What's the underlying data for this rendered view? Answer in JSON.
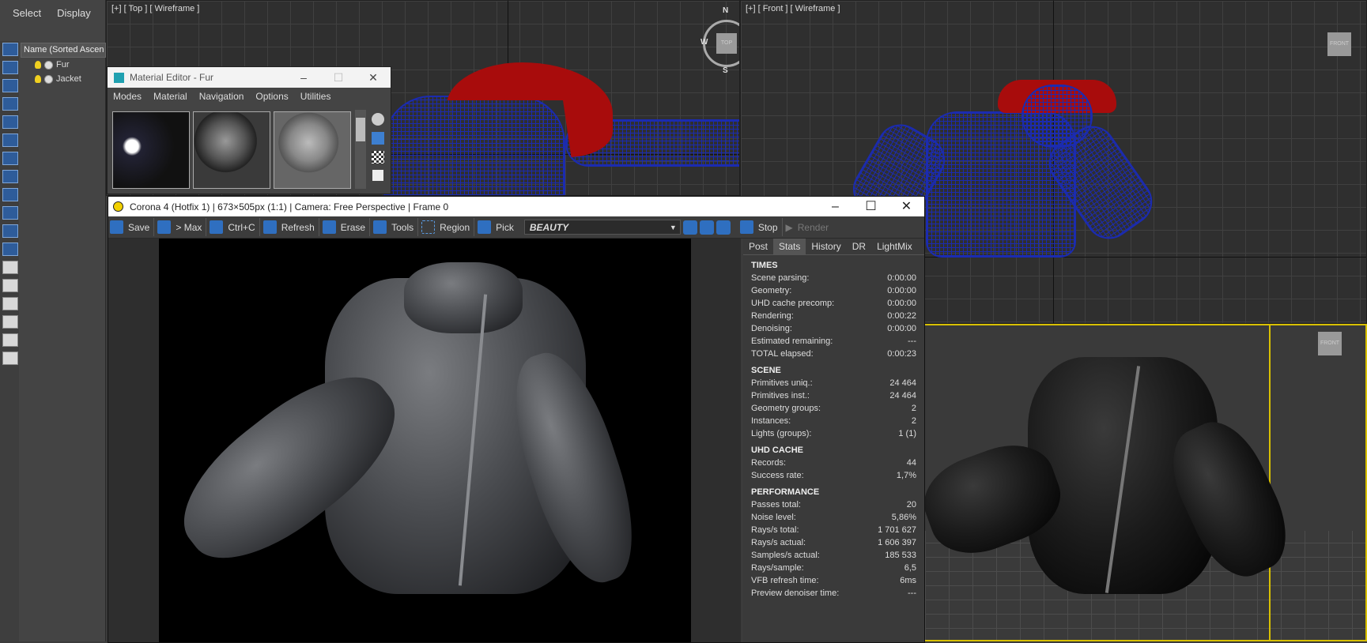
{
  "explorer": {
    "menu": [
      "Select",
      "Display"
    ],
    "column_header": "Name (Sorted Ascen",
    "nodes": [
      "Fur",
      "Jacket"
    ]
  },
  "viewport_top": {
    "label": "[+] [ Top ] [ Wireframe ]",
    "compass": {
      "n": "N",
      "s": "S",
      "e": "E",
      "w": "W",
      "center": "TOP"
    }
  },
  "viewport_front": {
    "label": "[+] [ Front ] [ Wireframe ]",
    "cube": "FRONT"
  },
  "viewport_persp": {
    "cube": "FRONT"
  },
  "material_editor": {
    "title": "Material Editor - Fur",
    "menus": [
      "Modes",
      "Material",
      "Navigation",
      "Options",
      "Utilities"
    ]
  },
  "corona": {
    "title": "Corona 4 (Hotfix 1) | 673×505px (1:1) | Camera: Free Perspective | Frame 0",
    "toolbar": {
      "save": "Save",
      "max": "> Max",
      "copy": "Ctrl+C",
      "refresh": "Refresh",
      "erase": "Erase",
      "tools": "Tools",
      "region": "Region",
      "pick": "Pick",
      "pass": "BEAUTY",
      "stop": "Stop",
      "render": "Render"
    },
    "tabs": [
      "Post",
      "Stats",
      "History",
      "DR",
      "LightMix"
    ],
    "active_tab": "Stats",
    "stats": {
      "times": {
        "title": "TIMES",
        "rows": [
          [
            "Scene parsing:",
            "0:00:00"
          ],
          [
            "Geometry:",
            "0:00:00"
          ],
          [
            "UHD cache precomp:",
            "0:00:00"
          ],
          [
            "Rendering:",
            "0:00:22"
          ],
          [
            "Denoising:",
            "0:00:00"
          ],
          [
            "Estimated remaining:",
            "---"
          ],
          [
            "TOTAL elapsed:",
            "0:00:23"
          ]
        ]
      },
      "scene": {
        "title": "SCENE",
        "rows": [
          [
            "Primitives uniq.:",
            "24 464"
          ],
          [
            "Primitives inst.:",
            "24 464"
          ],
          [
            "Geometry groups:",
            "2"
          ],
          [
            "Instances:",
            "2"
          ],
          [
            "Lights (groups):",
            "1 (1)"
          ]
        ]
      },
      "uhd": {
        "title": "UHD CACHE",
        "rows": [
          [
            "Records:",
            "44"
          ],
          [
            "Success rate:",
            "1,7%"
          ]
        ]
      },
      "perf": {
        "title": "PERFORMANCE",
        "rows": [
          [
            "Passes total:",
            "20"
          ],
          [
            "Noise level:",
            "5,86%"
          ],
          [
            "Rays/s total:",
            "1 701 627"
          ],
          [
            "Rays/s actual:",
            "1 606 397"
          ],
          [
            "Samples/s actual:",
            "185 533"
          ],
          [
            "Rays/sample:",
            "6,5"
          ],
          [
            "VFB refresh time:",
            "6ms"
          ],
          [
            "Preview denoiser time:",
            "---"
          ]
        ]
      }
    }
  },
  "colors": {
    "wire": "#1b2bb0",
    "fur": "#a80c0c",
    "accent": "#2f6fc0",
    "active_border": "#d8c000"
  }
}
